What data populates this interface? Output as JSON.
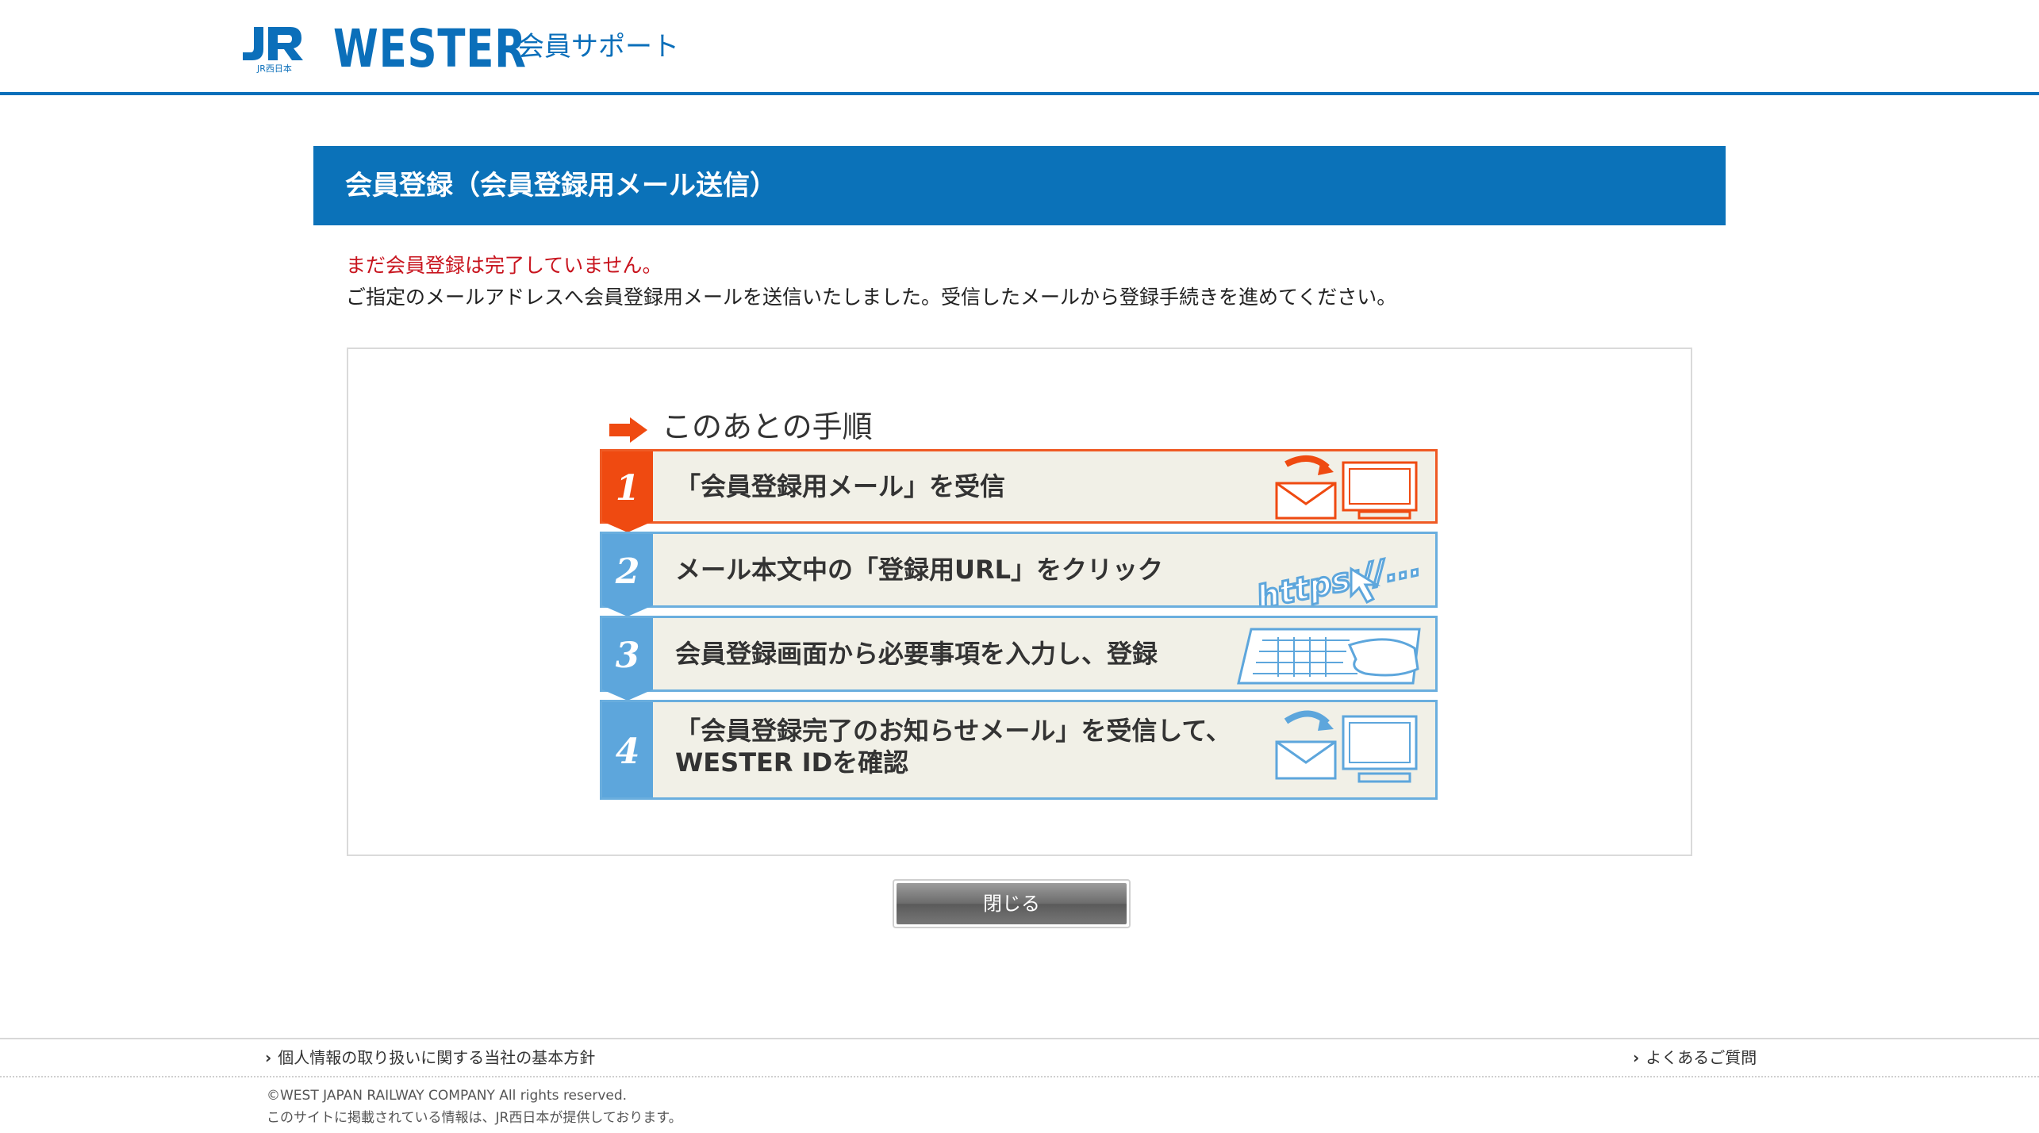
{
  "header": {
    "logo_text": "JR西日本",
    "brand": "WESTER",
    "subtitle": "会員サポート"
  },
  "page": {
    "title": "会員登録（会員登録用メール送信）",
    "notice": "まだ会員登録は完了していません。",
    "description": "ご指定のメールアドレスへ会員登録用メールを送信いたしました。受信したメールから登録手続きを進めてください。"
  },
  "steps": {
    "heading": "このあとの手順",
    "items": [
      {
        "number": "1",
        "label": "「会員登録用メール」を受信",
        "icon": "mail-to-computer-icon"
      },
      {
        "number": "2",
        "label": "メール本文中の「登録用URL」をクリック",
        "icon": "https-cursor-icon",
        "icon_text": "https://..."
      },
      {
        "number": "3",
        "label": "会員登録画面から必要事項を入力し、登録",
        "icon": "keyboard-typing-icon"
      },
      {
        "number": "4",
        "label_line1": "「会員登録完了のお知らせメール」を受信して、",
        "label_line2": "WESTER IDを確認",
        "icon": "mail-to-computer-icon"
      }
    ]
  },
  "buttons": {
    "close": "閉じる"
  },
  "footer": {
    "privacy_link": "個人情報の取り扱いに関する当社の基本方針",
    "faq_link": "よくあるご質問",
    "copyright": "©WEST JAPAN RAILWAY COMPANY All rights reserved.",
    "provided_by": "このサイトに掲載されている情報は、JR西日本が提供しております。"
  },
  "colors": {
    "brand_blue": "#0b6fba",
    "step1_orange": "#ef4a11",
    "step_blue": "#5da6dc",
    "notice_red": "#c8141e"
  }
}
